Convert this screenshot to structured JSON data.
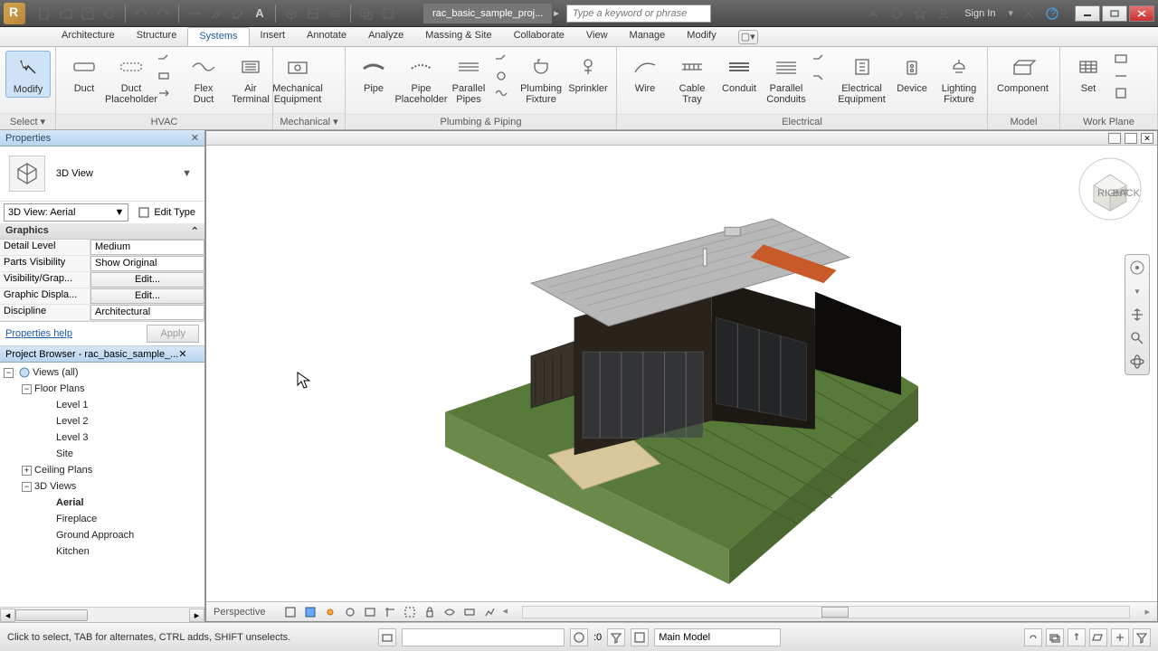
{
  "titlebar": {
    "doc_tab": "rac_basic_sample_proj...",
    "search_placeholder": "Type a keyword or phrase",
    "signin": "Sign In"
  },
  "ribbon": {
    "tabs": [
      "Architecture",
      "Structure",
      "Systems",
      "Insert",
      "Annotate",
      "Analyze",
      "Massing & Site",
      "Collaborate",
      "View",
      "Manage",
      "Modify"
    ],
    "active_tab": "Systems",
    "groups": {
      "select": {
        "label": "Select ▾",
        "modify": "Modify"
      },
      "hvac": {
        "label": "HVAC",
        "buttons": [
          "Duct",
          "Duct\nPlaceholder",
          "Flex\nDuct",
          "Air\nTerminal",
          "Mechanical\nEquipment"
        ]
      },
      "mechanical": {
        "label": "Mechanical ▾"
      },
      "plumbing": {
        "label": "Plumbing & Piping",
        "buttons": [
          "Pipe",
          "Pipe\nPlaceholder",
          "Parallel\nPipes",
          "Plumbing\nFixture",
          "Sprinkler",
          "Wire"
        ]
      },
      "electrical": {
        "label": "Electrical",
        "buttons": [
          "Cable\nTray",
          "Conduit",
          "Parallel\nConduits",
          "Electrical\nEquipment",
          "Device",
          "Lighting\nFixture"
        ]
      },
      "model": {
        "label": "Model",
        "buttons": [
          "Component"
        ]
      },
      "workplane": {
        "label": "Work Plane",
        "buttons": [
          "Set"
        ]
      }
    }
  },
  "properties": {
    "title": "Properties",
    "type_name": "3D View",
    "instance": "3D View: Aerial",
    "edit_type": "Edit Type",
    "category": "Graphics",
    "rows": {
      "detail_level": {
        "k": "Detail Level",
        "v": "Medium"
      },
      "parts": {
        "k": "Parts Visibility",
        "v": "Show Original"
      },
      "visgraph": {
        "k": "Visibility/Grap...",
        "v": "Edit..."
      },
      "gdisp": {
        "k": "Graphic Displa...",
        "v": "Edit..."
      },
      "disc": {
        "k": "Discipline",
        "v": "Architectural"
      }
    },
    "help": "Properties help",
    "apply": "Apply"
  },
  "project_browser": {
    "title": "Project Browser - rac_basic_sample_...",
    "root": "Views (all)",
    "floor_plans": {
      "label": "Floor Plans",
      "items": [
        "Level 1",
        "Level 2",
        "Level 3",
        "Site"
      ]
    },
    "ceiling": "Ceiling Plans",
    "views3d": {
      "label": "3D Views",
      "items": [
        "Aerial",
        "Fireplace",
        "Ground Approach",
        "Kitchen"
      ]
    }
  },
  "viewport": {
    "footer_label": "Perspective"
  },
  "statusbar": {
    "msg": "Click to select, TAB for alternates, CTRL adds, SHIFT unselects.",
    "filter_count": ":0",
    "workset": "Main Model"
  }
}
